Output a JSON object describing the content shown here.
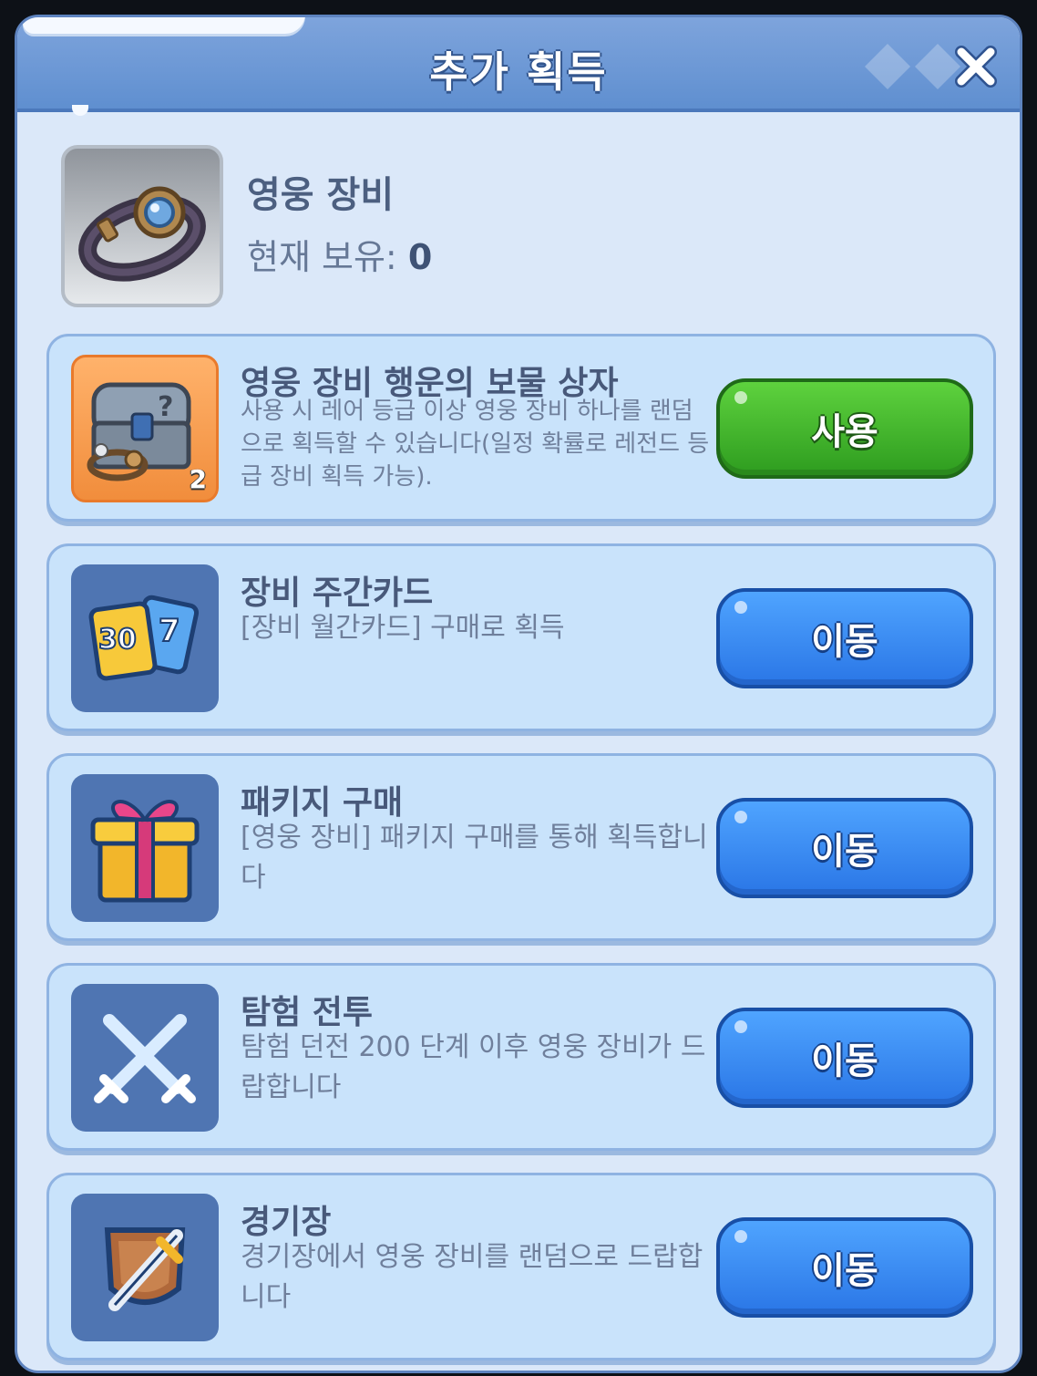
{
  "header": {
    "title": "추가 획득",
    "close_icon": "close-icon"
  },
  "item": {
    "name": "영웅 장비",
    "owned_label": "현재 보유:",
    "owned_value": "0",
    "icon": "equipment-bracelet-icon"
  },
  "sources": [
    {
      "title": "영웅 장비 행운의 보물 상자",
      "desc": "사용 시 레어 등급 이상 영웅 장비 하나를 랜덤으로 획득할 수 있습니다(일정 확률로 레전드 등급 장비 획득 가능).",
      "button": "사용",
      "icon": "treasure-chest-icon",
      "count": "2"
    },
    {
      "title": "장비 주간카드",
      "desc": "[장비 월간카드] 구매로 획득",
      "button": "이동",
      "icon": "weekly-card-icon",
      "card_numbers": [
        "30",
        "7"
      ]
    },
    {
      "title": "패키지 구매",
      "desc": "[영웅 장비] 패키지 구매를 통해 획득합니다",
      "button": "이동",
      "icon": "gift-box-icon"
    },
    {
      "title": "탐험 전투",
      "desc": "탐험 던전 200 단계 이후 영웅 장비가 드랍합니다",
      "button": "이동",
      "icon": "crossed-swords-icon"
    },
    {
      "title": "경기장",
      "desc": "경기장에서 영웅 장비를 랜덤으로 드랍합니다",
      "button": "이동",
      "icon": "arena-sword-shield-icon"
    }
  ],
  "colors": {
    "panel_bg": "#dbe8f9",
    "header": "#6b98d6",
    "card_bg": "#c9e3fb",
    "green_button": "#3cb52a",
    "blue_button": "#3a8cf2"
  }
}
